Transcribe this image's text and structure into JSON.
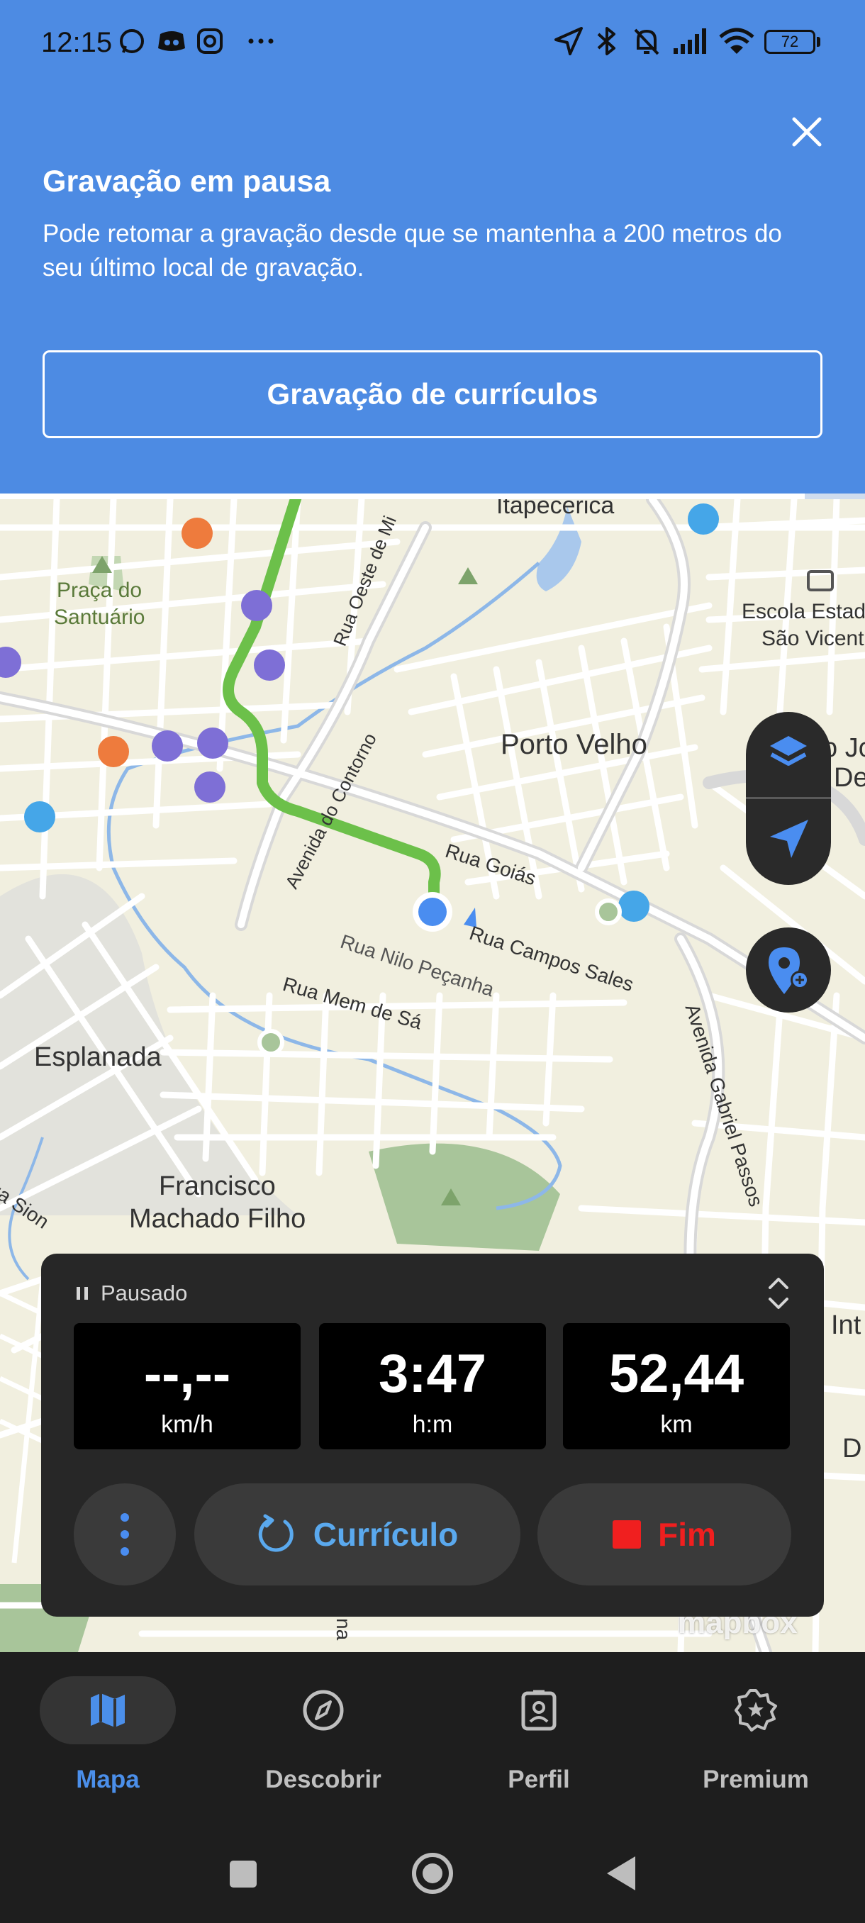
{
  "status_bar": {
    "time": "12:15",
    "left_icons": [
      "whatsapp-icon",
      "discord-icon",
      "instagram-icon",
      "more-notifications-icon"
    ],
    "right_icons": [
      "location-arrow-icon",
      "bluetooth-icon",
      "bell-muted-icon",
      "signal-icon",
      "wifi-icon"
    ],
    "battery": "72"
  },
  "banner": {
    "title": "Gravação em pausa",
    "description": "Pode retomar a gravação desde que se mantenha a 200 metros do seu último local de gravação.",
    "button_label": "Gravação de currículos",
    "progress_fraction": 0.93
  },
  "map": {
    "labels": {
      "itapecerica": "Itapecerica",
      "praca_l1": "Praça do",
      "praca_l2": "Santuário",
      "rua_oeste": "Rua Oeste de Mi",
      "escola_l1": "Escola Estad",
      "escola_l2": "São Vicent",
      "porto_velho": "Porto Velho",
      "partial_jo": "o Jo",
      "partial_de": "De",
      "avenida_contorno": "Avenida do Contorno",
      "rua_goias": "Rua Goiás",
      "rua_campos_sales": "Rua Campos Sales",
      "rua_nilo": "Rua Nilo Peçanha",
      "rua_mem": "Rua Mem de Sá",
      "av_gabriel": "Avenida Gabriel Passos",
      "esplanada": "Esplanada",
      "rua_sion": "ua Sion",
      "francisco_l1": "Francisco",
      "francisco_l2": "Machado Filho",
      "partial_int": "Int",
      "partial_d": "D",
      "partial_na": "na"
    },
    "attribution": "mapbox",
    "colors": {
      "route": "#6cc04a",
      "location": "#4a8df0"
    }
  },
  "recording": {
    "status": "Pausado",
    "stats": [
      {
        "value": "--,--",
        "unit": "km/h"
      },
      {
        "value": "3:47",
        "unit": "h:m"
      },
      {
        "value": "52,44",
        "unit": "km"
      }
    ],
    "resume_label": "Currículo",
    "finish_label": "Fim"
  },
  "nav": {
    "items": [
      {
        "label": "Mapa",
        "icon": "map-icon",
        "active": true
      },
      {
        "label": "Descobrir",
        "icon": "compass-icon",
        "active": false
      },
      {
        "label": "Perfil",
        "icon": "profile-icon",
        "active": false
      },
      {
        "label": "Premium",
        "icon": "premium-badge-icon",
        "active": false
      }
    ]
  }
}
